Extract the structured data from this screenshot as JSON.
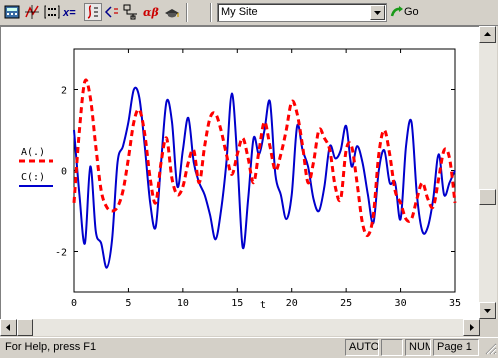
{
  "toolbar": {
    "icons": [
      "calculator-toolbar-icon",
      "graph-toolbar-icon",
      "matrix-toolbar-icon",
      "evaluation-toolbar-icon",
      "calculus-toolbar-icon",
      "boolean-toolbar-icon",
      "programming-toolbar-icon",
      "greek-toolbar-icon",
      "symbolic-toolbar-icon"
    ],
    "evaluation_label": "x=",
    "greek_label": "αβ",
    "site_combo_value": "My Site",
    "go_label": "Go"
  },
  "chart_data": {
    "type": "line",
    "xlabel": "t",
    "xlim": [
      0,
      35
    ],
    "ylim": [
      -3,
      3
    ],
    "x_ticks": [
      "0",
      "5",
      "10",
      "15",
      "20",
      "25",
      "30",
      "35"
    ],
    "y_ticks": [
      "2",
      "0",
      "-2"
    ],
    "legend_position": "left",
    "series": [
      {
        "name": "A(.)",
        "color": "#ff0000",
        "style": "dashed",
        "x": [
          0,
          0.5,
          1,
          1.5,
          2,
          2.5,
          3,
          3.5,
          4,
          4.5,
          5,
          5.5,
          6,
          6.5,
          7,
          7.5,
          8,
          8.5,
          9,
          9.5,
          10,
          10.5,
          11,
          11.5,
          12,
          12.5,
          13,
          13.5,
          14,
          14.5,
          15,
          15.5,
          16,
          16.5,
          17,
          17.5,
          18,
          18.5,
          19,
          19.5,
          20,
          20.5,
          21,
          21.5,
          22,
          22.5,
          23,
          23.5,
          24,
          24.5,
          25,
          25.5,
          26,
          26.5,
          27,
          27.5,
          28,
          28.5,
          29,
          29.5,
          30,
          30.5,
          31,
          31.5,
          32,
          32.5,
          33,
          33.5,
          34,
          34.5,
          35
        ],
        "y": [
          -0.8,
          1.0,
          2.2,
          1.8,
          0.6,
          -0.5,
          -0.9,
          -1.0,
          -0.9,
          -0.5,
          0.3,
          1.2,
          1.5,
          0.9,
          -0.2,
          -0.8,
          0.2,
          0.8,
          -0.2,
          -0.6,
          -0.4,
          0.2,
          0.5,
          -0.3,
          0.6,
          1.3,
          1.4,
          1.0,
          0.4,
          -0.1,
          0.4,
          0.8,
          0.3,
          -0.3,
          0.5,
          1.2,
          0.6,
          0.0,
          0.4,
          1.0,
          1.7,
          1.4,
          0.6,
          -0.3,
          0.2,
          1.0,
          0.8,
          0.5,
          -0.4,
          -0.7,
          0.5,
          0.6,
          -0.3,
          -1.3,
          -1.6,
          -1.1,
          0.4,
          1.0,
          0.4,
          -0.5,
          -0.8,
          -1.2,
          -1.2,
          -0.7,
          -0.3,
          -0.7,
          -0.9,
          -0.2,
          0.5,
          0.3,
          -0.8
        ]
      },
      {
        "name": "C(:)",
        "color": "#0000cc",
        "style": "solid",
        "x": [
          0,
          0.5,
          1,
          1.5,
          2,
          2.5,
          3,
          3.5,
          4,
          4.5,
          5,
          5.5,
          6,
          6.5,
          7,
          7.5,
          8,
          8.5,
          9,
          9.5,
          10,
          10.5,
          11,
          11.5,
          12,
          12.5,
          13,
          13.5,
          14,
          14.5,
          15,
          15.5,
          16,
          16.5,
          17,
          17.5,
          18,
          18.5,
          19,
          19.5,
          20,
          20.5,
          21,
          21.5,
          22,
          22.5,
          23,
          23.5,
          24,
          24.5,
          25,
          25.5,
          26,
          26.5,
          27,
          27.5,
          28,
          28.5,
          29,
          29.5,
          30,
          30.5,
          31,
          31.5,
          32,
          32.5,
          33,
          33.5,
          34,
          34.5,
          35
        ],
        "y": [
          1.0,
          -0.6,
          -1.8,
          0.1,
          -1.5,
          -1.8,
          -2.4,
          -1.7,
          0.2,
          0.6,
          1.2,
          2.0,
          1.8,
          0.6,
          -0.8,
          -1.4,
          0.2,
          1.7,
          1.2,
          -0.4,
          0.5,
          1.3,
          0.2,
          -0.3,
          -0.6,
          -1.1,
          -1.7,
          -1.0,
          0.2,
          1.9,
          0.3,
          -1.9,
          -0.7,
          0.8,
          0.4,
          1.0,
          1.7,
          -0.1,
          -0.6,
          -1.2,
          -0.6,
          1.1,
          0.5,
          0.1,
          -0.7,
          -1.0,
          -0.4,
          0.6,
          0.3,
          0.5,
          1.1,
          0.1,
          0.6,
          0.2,
          -0.6,
          -1.3,
          0.0,
          0.5,
          -0.3,
          -0.3,
          -1.2,
          0.6,
          1.2,
          -0.6,
          -1.5,
          -1.4,
          -0.7,
          0.4,
          -0.6,
          -0.3,
          0.0
        ]
      }
    ]
  },
  "scrollbars": {
    "vertical_position": 0.6,
    "horizontal_position": 0.0
  },
  "statusbar": {
    "message": "For Help, press F1",
    "auto_mode": "AUTO",
    "num_indicator": "NUM",
    "page_indicator": "Page 1"
  }
}
